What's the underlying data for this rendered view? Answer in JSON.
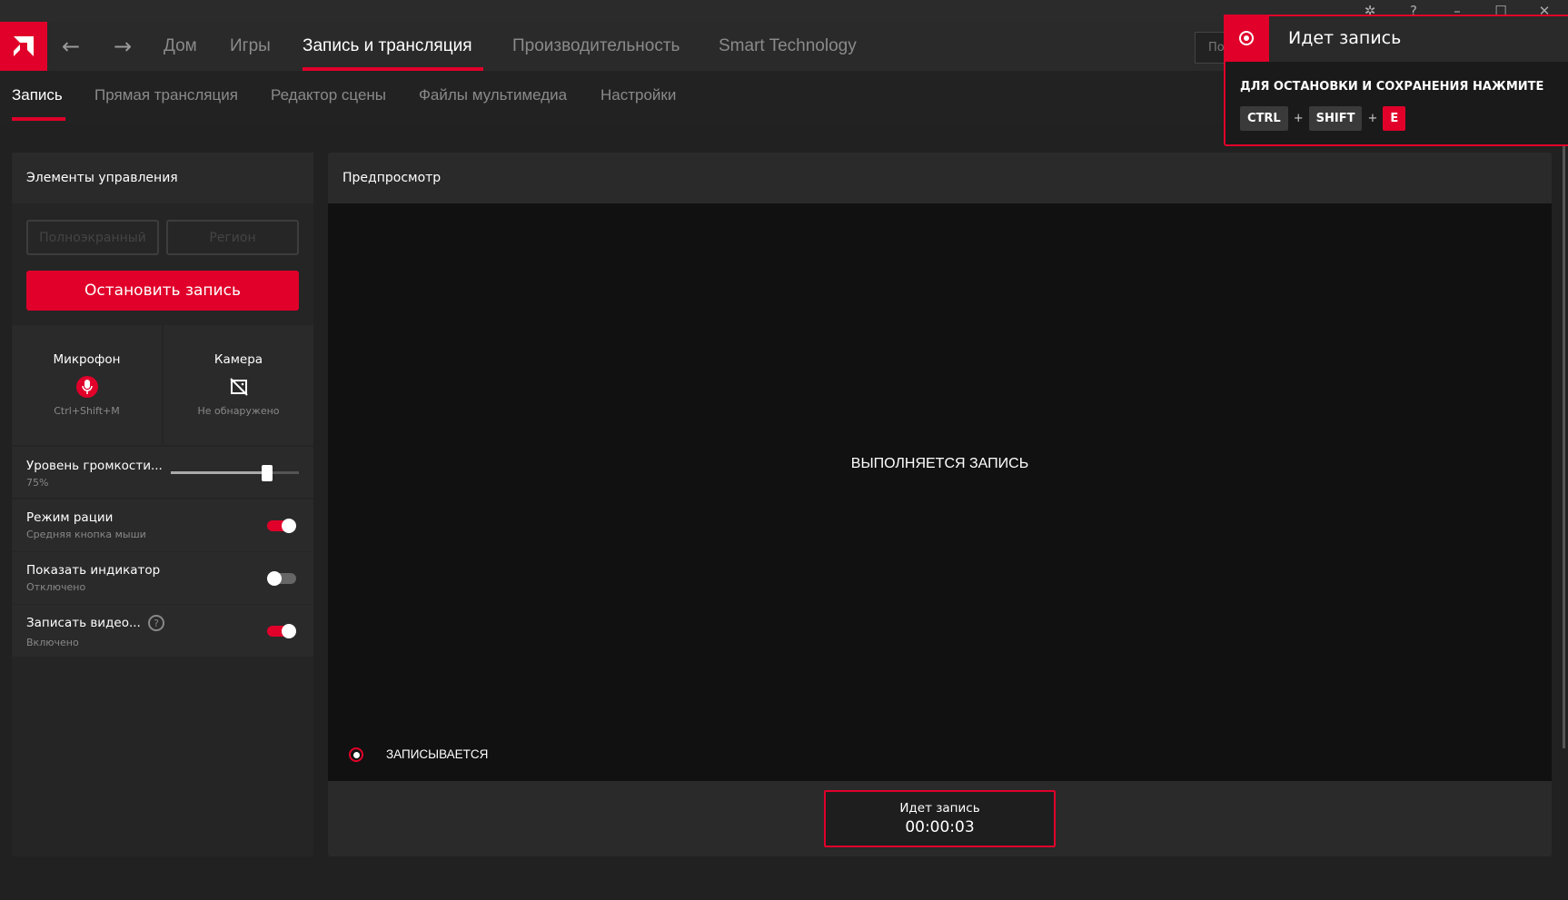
{
  "window": {
    "icons": [
      "bug-icon",
      "help-icon",
      "minimize-icon",
      "maximize-icon",
      "close-icon"
    ]
  },
  "nav": {
    "items": [
      "Дом",
      "Игры",
      "Запись и трансляция",
      "Производительность",
      "Smart Technology"
    ],
    "active": 2,
    "search_partial": "По"
  },
  "subnav": {
    "items": [
      "Запись",
      "Прямая трансляция",
      "Редактор сцены",
      "Файлы мультимедиа",
      "Настройки"
    ],
    "active": 0
  },
  "controls": {
    "title": "Элементы управления",
    "fullscreen_label": "Полноэкранный",
    "region_label": "Регион",
    "stop_label": "Остановить запись",
    "mic": {
      "label": "Микрофон",
      "hint": "Ctrl+Shift+M"
    },
    "camera": {
      "label": "Камера",
      "hint": "Не обнаружено"
    },
    "volume": {
      "label": "Уровень громкости...",
      "value_text": "75%",
      "value": 75
    },
    "push_to_talk": {
      "label": "Режим рации",
      "sub": "Средняя кнопка мыши",
      "on": true
    },
    "indicator": {
      "label": "Показать индикатор",
      "sub": "Отключено",
      "on": false
    },
    "record_video": {
      "label": "Записать видео...",
      "sub": "Включено",
      "on": true
    }
  },
  "preview": {
    "title": "Предпросмотр",
    "center_text": "ВЫПОЛНЯЕТСЯ ЗАПИСЬ",
    "status": "ЗАПИСЫВАЕТСЯ",
    "box_title": "Идет запись",
    "timer": "00:00:03"
  },
  "toast": {
    "title": "Идет запись",
    "instruction": "ДЛЯ ОСТАНОВКИ И СОХРАНЕНИЯ НАЖМИТЕ",
    "keys": [
      "CTRL",
      "SHIFT",
      "E"
    ],
    "plus": "+"
  },
  "colors": {
    "accent": "#e0002a"
  }
}
